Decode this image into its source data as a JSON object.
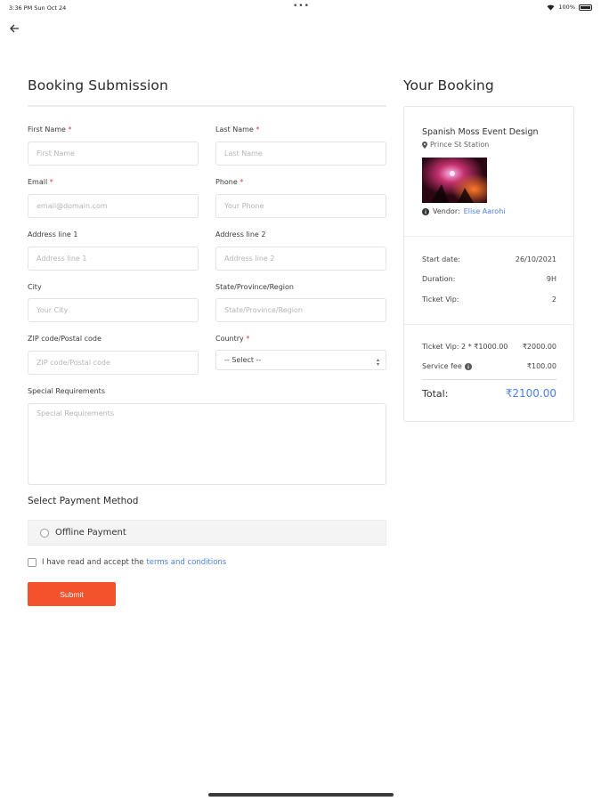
{
  "status_bar": {
    "time": "3:36 PM  Sun Oct 24",
    "battery": "100%"
  },
  "form": {
    "title": "Booking Submission",
    "first_name": {
      "label": "First Name",
      "placeholder": "First Name"
    },
    "last_name": {
      "label": "Last Name",
      "placeholder": "Last Name"
    },
    "email": {
      "label": "Email",
      "placeholder": "email@domain.com"
    },
    "phone": {
      "label": "Phone",
      "placeholder": "Your Phone"
    },
    "address1": {
      "label": "Address line 1",
      "placeholder": "Address line 1"
    },
    "address2": {
      "label": "Address line 2",
      "placeholder": "Address line 2"
    },
    "city": {
      "label": "City",
      "placeholder": "Your City"
    },
    "state": {
      "label": "State/Province/Region",
      "placeholder": "State/Province/Region"
    },
    "zip": {
      "label": "ZIP code/Postal code",
      "placeholder": "ZIP code/Postal code"
    },
    "country": {
      "label": "Country",
      "selected": "-- Select --"
    },
    "special": {
      "label": "Special Requirements",
      "placeholder": "Special Requirements"
    },
    "required_mark": "*"
  },
  "payment": {
    "title": "Select Payment Method",
    "option_offline": "Offline Payment",
    "terms_text": "I have read and accept the",
    "terms_link": "terms and conditions",
    "submit_label": "Submit"
  },
  "booking": {
    "title": "Your Booking",
    "event_name": "Spanish Moss Event Design",
    "location": "Prince St Station",
    "vendor_label": "Vendor:",
    "vendor_name": "Elise Aarohi",
    "start_label": "Start date:",
    "start_value": "26/10/2021",
    "duration_label": "Duration:",
    "duration_value": "9H",
    "ticket_label": "Ticket Vip:",
    "ticket_value": "2",
    "ticket_calc_label": "Ticket Vip: 2 * ₹1000.00",
    "ticket_calc_value": "₹2000.00",
    "service_label": "Service fee",
    "service_value": "₹100.00",
    "total_label": "Total:",
    "total_value": "₹2100.00"
  },
  "colors": {
    "accent": "#f4522d",
    "link": "#4a80e8",
    "required": "#e53935"
  }
}
